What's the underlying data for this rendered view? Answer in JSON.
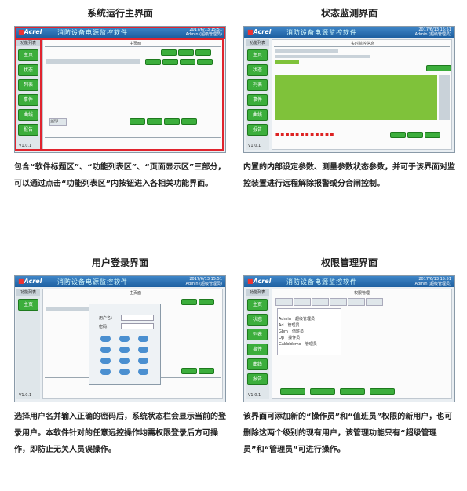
{
  "panels": [
    {
      "title": "系统运行主界面",
      "desc": "包含“软件标题区”、“功能列表区”、“页面显示区”三部分，可以通过点击“功能列表区”内按钮进入各相关功能界面。",
      "nav": [
        "主页",
        "状态",
        "列表",
        "事件",
        "曲线",
        "报告"
      ],
      "page_title": "主页面",
      "tab": "主页1"
    },
    {
      "title": "状态监测界面",
      "desc": "内置的内部设定参数、测量参数状态参数，并可于该界面对监控装置进行远程解除报警或分合闸控制。",
      "nav": [
        "主页",
        "状态",
        "列表",
        "事件",
        "曲线",
        "报告"
      ],
      "page_title": "实时监控信息"
    },
    {
      "title": "用户登录界面",
      "desc": "选择用户名并输入正确的密码后，系统状态栏会显示当前的登录用户。本软件针对的任意远控操作均需权限登录后方可操作，即防止无关人员误操作。",
      "nav": [
        "主页"
      ],
      "page_title": "主页面",
      "dialog_user": "用户名：",
      "dialog_pwd": "密码："
    },
    {
      "title": "权限管理界面",
      "desc": "该界面可添加新的“操作员”和“值班员”权限的新用户，也可删除这两个级别的现有用户，该管理功能只有“超级管理员”和“管理员”可进行操作。",
      "nav": [
        "主页",
        "状态",
        "列表",
        "事件",
        "曲线",
        "报告"
      ],
      "page_title": "权限管理",
      "users": [
        {
          "name": "Admin",
          "role": "超级管理员"
        },
        {
          "name": "Ad",
          "role": "管理员"
        },
        {
          "name": "Gbm",
          "role": "值班员"
        },
        {
          "name": "Op",
          "role": "操作员"
        },
        {
          "name": "Gabbldemo",
          "role": "管理员"
        }
      ],
      "buttons": [
        "添加新用户",
        "修改用户",
        "删除用户",
        "退出管理"
      ]
    }
  ],
  "app": {
    "logo": "Acrel",
    "title": "消防设备电源监控软件",
    "version": "V1.0.1",
    "nav_header": "功能列表",
    "datetime": "2017/6/13 15:51",
    "user": "Admin (超级管理员)"
  },
  "colors": {
    "accent": "#3cae3c",
    "title_bar": "#1d5fa0",
    "highlight": "#e0242e"
  }
}
